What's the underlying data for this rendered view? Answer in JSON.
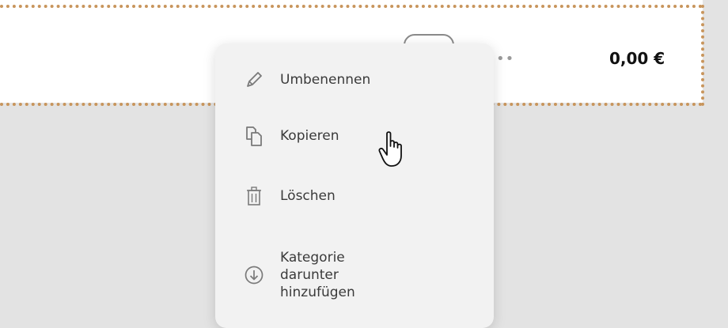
{
  "row": {
    "dots": "••",
    "amount": "0,00 €"
  },
  "menu": {
    "items": [
      {
        "label": "Umbenennen",
        "icon": "pencil-icon"
      },
      {
        "label": "Kopieren",
        "icon": "copy-icon"
      },
      {
        "label": "Löschen",
        "icon": "trash-icon"
      },
      {
        "label": "Kategorie\ndarunter\nhinzufügen",
        "icon": "arrow-down-circle-icon"
      }
    ]
  },
  "colors": {
    "dotted_border": "#c8955c",
    "menu_bg": "#f2f2f2",
    "page_bg": "#e3e3e3"
  }
}
